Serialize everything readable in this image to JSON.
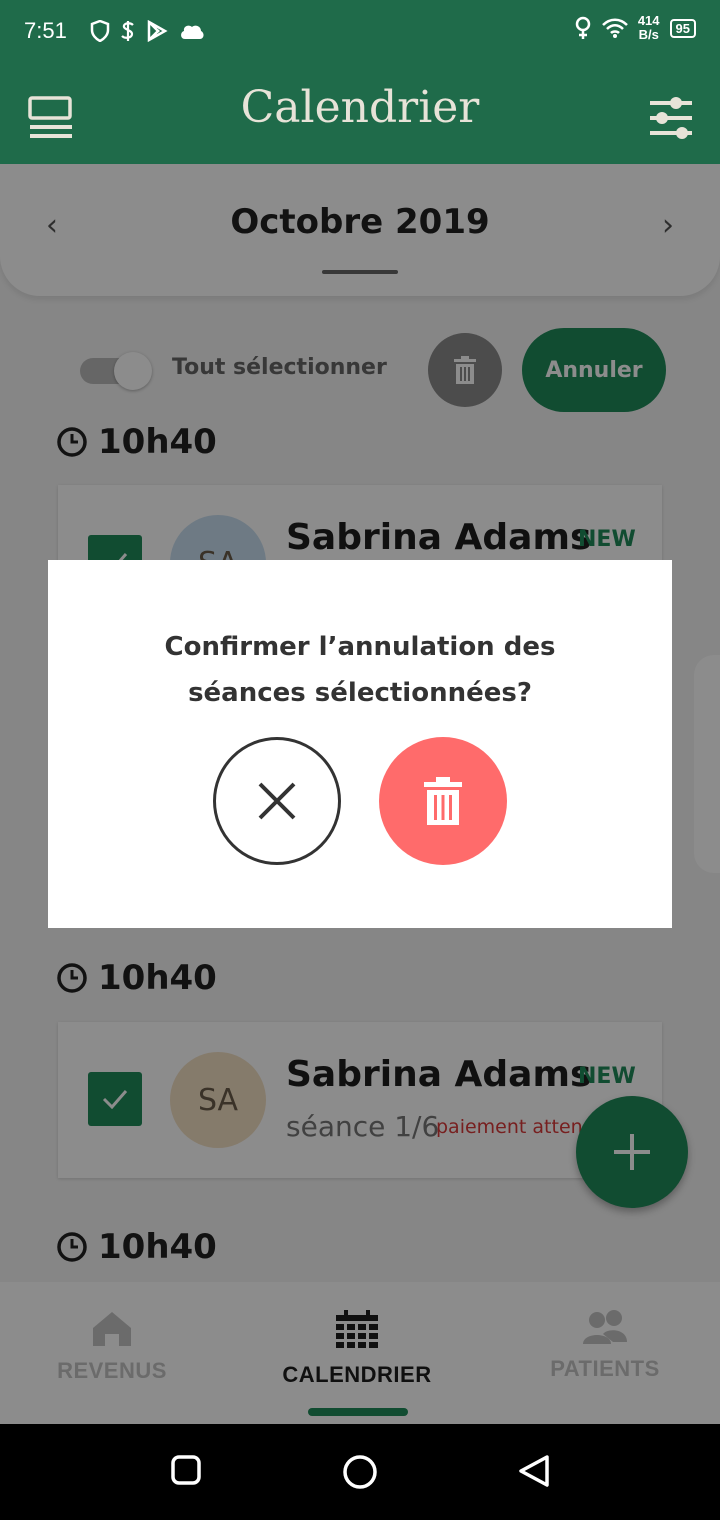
{
  "status_bar": {
    "time": "7:51",
    "net_speed": "414",
    "net_unit": "B/s",
    "battery": "95"
  },
  "header": {
    "title": "Calendrier"
  },
  "month_bar": {
    "month": "Octobre 2019"
  },
  "selection": {
    "select_all_label": "Tout sélectionner",
    "cancel_label": "Annuler"
  },
  "slots": [
    {
      "time": "10h40",
      "name": "Sabrina Adams",
      "badge": "NEW",
      "initials": "SA"
    },
    {
      "time": "10h40",
      "name": "Sabrina Adams",
      "badge": "NEW",
      "initials": "SA",
      "session": "séance 1/6",
      "payment": "paiement atten"
    },
    {
      "time": "10h40"
    }
  ],
  "dialog": {
    "line1": "Confirmer l’annulation des",
    "line2": "séances sélectionnées?"
  },
  "bottom_nav": {
    "revenus": "REVENUS",
    "calendrier": "CALENDRIER",
    "patients": "PATIENTS"
  },
  "colors": {
    "primary": "#1f6b4a",
    "accent": "#1f8a5a",
    "danger": "#ff6b6b",
    "payment_red": "#d93a3a"
  }
}
